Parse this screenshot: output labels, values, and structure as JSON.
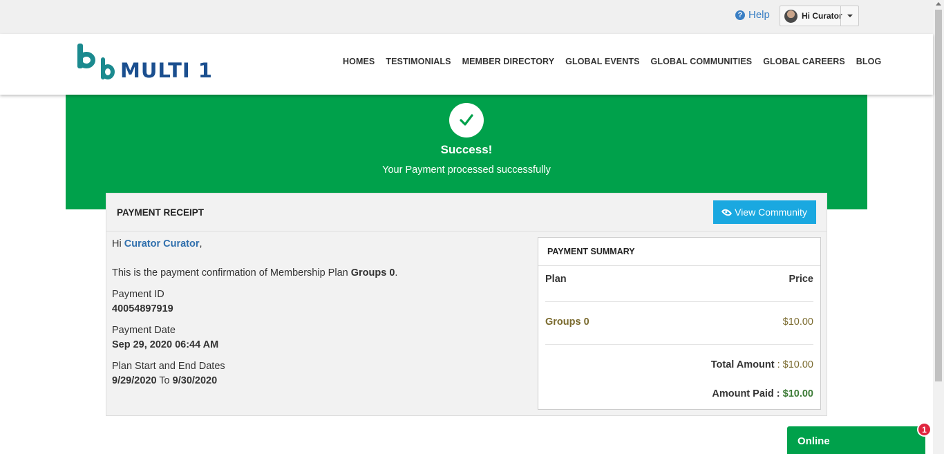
{
  "topbar": {
    "help_label": "Help",
    "user_label": "Hi Curator"
  },
  "header": {
    "logo_text": "MULTI 1",
    "nav": [
      "HOMES",
      "TESTIMONIALS",
      "MEMBER DIRECTORY",
      "GLOBAL EVENTS",
      "GLOBAL COMMUNITIES",
      "GLOBAL CAREERS",
      "BLOG"
    ]
  },
  "banner": {
    "title": "Success!",
    "subtitle": "Your Payment processed successfully"
  },
  "receipt": {
    "title": "PAYMENT RECEIPT",
    "view_button": "View Community",
    "greeting_prefix": "Hi",
    "user_name": "Curator Curator",
    "greeting_suffix": ",",
    "confirmation_text": "This is the payment confirmation of Membership Plan",
    "plan_name": "Groups 0",
    "confirmation_end": ".",
    "payment_id_label": "Payment ID",
    "payment_id": "40054897919",
    "payment_date_label": "Payment Date",
    "payment_date": "Sep 29, 2020 06:44 AM",
    "plan_dates_label": "Plan Start and End Dates",
    "start_date": "9/29/2020",
    "dates_separator": "To",
    "end_date": "9/30/2020"
  },
  "summary": {
    "title": "PAYMENT SUMMARY",
    "plan_header": "Plan",
    "price_header": "Price",
    "plan_name": "Groups 0",
    "plan_price": "$10.00",
    "total_label": "Total Amount",
    "total_value": ": $10.00",
    "paid_label": "Amount Paid :",
    "paid_value": "$10.00"
  },
  "chat": {
    "label": "Online",
    "badge": "1"
  },
  "colors": {
    "success_green": "#00a14b",
    "link_blue": "#2f6fad",
    "button_blue": "#1aa8e0",
    "badge_red": "#e0263f"
  }
}
